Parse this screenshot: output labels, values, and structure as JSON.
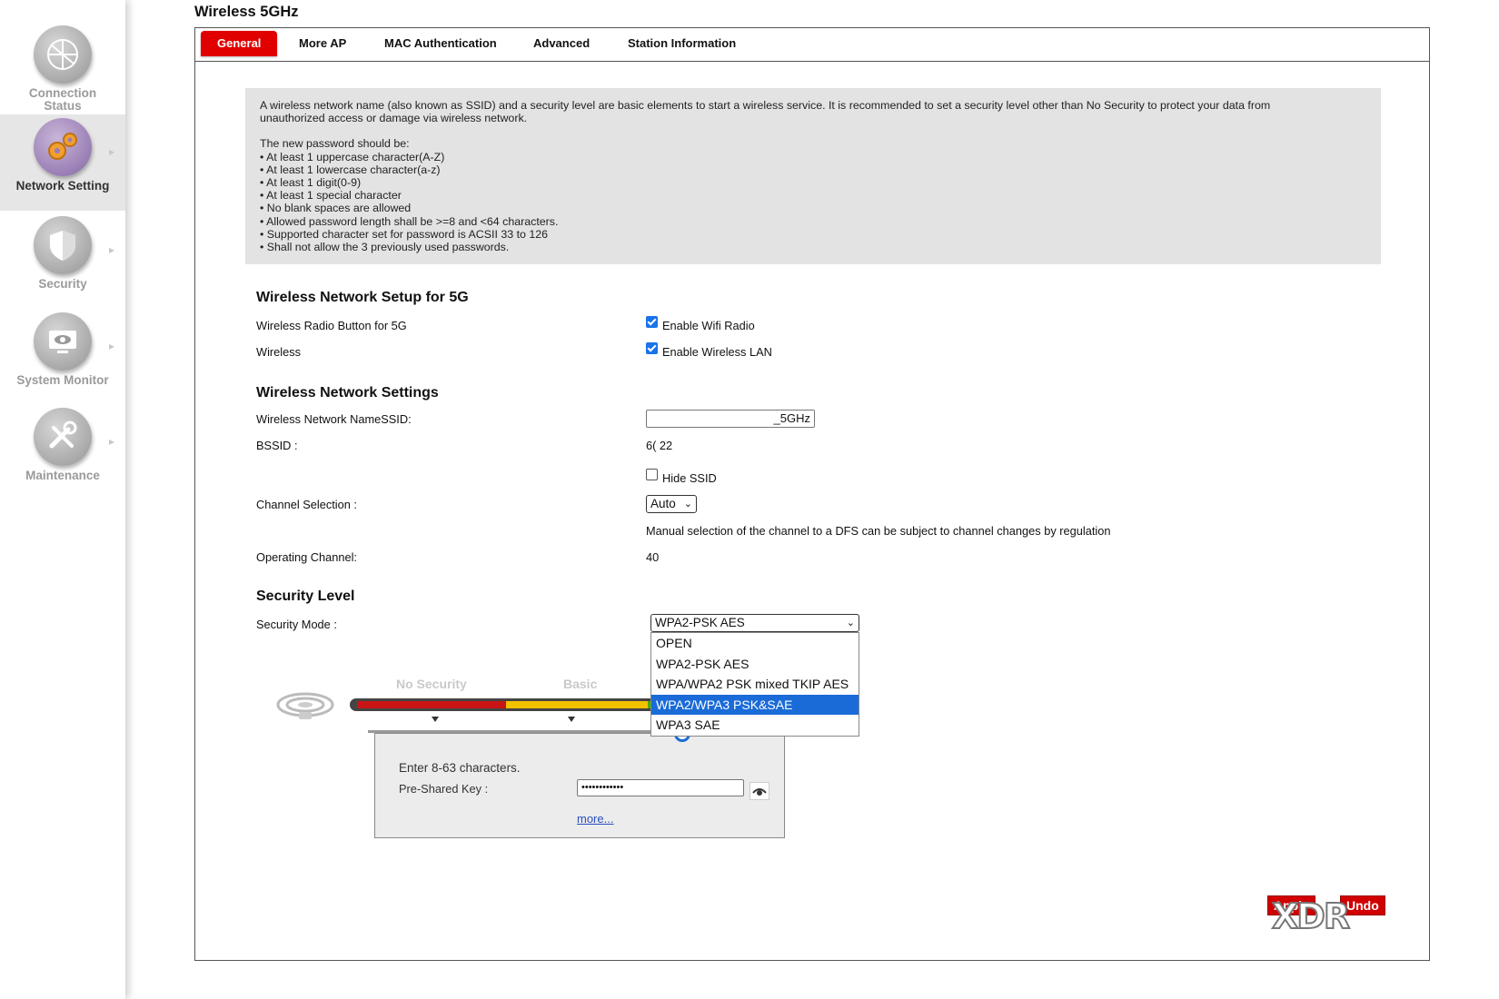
{
  "sidebar": {
    "items": [
      {
        "label_line1": "Connection",
        "label_line2": "Status",
        "icon": "connection-globe-icon"
      },
      {
        "label_line1": "Network Setting",
        "label_line2": "",
        "icon": "gears-icon"
      },
      {
        "label_line1": "Security",
        "label_line2": "",
        "icon": "shield-icon"
      },
      {
        "label_line1": "System Monitor",
        "label_line2": "",
        "icon": "monitor-eye-icon"
      },
      {
        "label_line1": "Maintenance",
        "label_line2": "",
        "icon": "tools-icon"
      }
    ]
  },
  "page": {
    "title": "Wireless 5GHz"
  },
  "tabs": [
    "General",
    "More AP",
    "MAC Authentication",
    "Advanced",
    "Station Information"
  ],
  "info": {
    "intro_line1": "A wireless network name (also known as SSID) and a security level are basic elements to start a wireless service. It is recommended to set a security level other than No Security to protect your data from",
    "intro_line2": "unauthorized access or damage via wireless network.",
    "pw_title": "The new password should be:",
    "rules": [
      "• At least 1 uppercase character(A-Z)",
      "• At least 1 lowercase character(a-z)",
      "• At least 1 digit(0-9)",
      "• At least 1 special character",
      "• No blank spaces are allowed",
      "• Allowed password length shall be >=8 and <64 characters.",
      "• Supported character set for password is ACSII 33 to 126",
      "• Shall not allow the 3 previously used passwords."
    ]
  },
  "setup": {
    "title": "Wireless Network Setup for 5G",
    "radio_label": "Wireless Radio Button for 5G",
    "radio_option": "Enable Wifi Radio",
    "wireless_label": "Wireless",
    "wireless_option": "Enable Wireless LAN"
  },
  "settings": {
    "title": "Wireless Network Settings",
    "ssid_label": "Wireless Network NameSSID:",
    "ssid_value": "_5GHz",
    "bssid_label": "BSSID :",
    "bssid_value": "6(                    22",
    "hide_ssid": "Hide SSID",
    "channel_label": "Channel Selection :",
    "channel_value": "Auto",
    "channel_note": "Manual selection of the channel to a DFS can be subject to channel changes by regulation",
    "op_channel_label": "Operating Channel:",
    "op_channel_value": "40"
  },
  "security": {
    "title": "Security Level",
    "mode_label": "Security Mode :",
    "mode_value": "WPA2-PSK AES",
    "options": [
      "OPEN",
      "WPA2-PSK AES",
      "WPA/WPA2 PSK mixed TKIP AES",
      "WPA2/WPA3 PSK&SAE",
      "WPA3 SAE"
    ],
    "highlighted_option": "WPA2/WPA3 PSK&SAE",
    "meter_no_security": "No Security",
    "meter_basic": "Basic",
    "psk_hint": "Enter 8-63 characters.",
    "psk_label": "Pre-Shared Key :",
    "psk_value": "••••••••••••",
    "more_link": "more..."
  },
  "buttons": {
    "apply": "Apply",
    "undo": "Undo"
  },
  "watermark": "XDR",
  "colors": {
    "accent_red": "#e10000",
    "select_blue": "#1a6bd8",
    "meter_red": "#c81414",
    "meter_yellow": "#f2c200",
    "meter_green": "#45b000"
  }
}
